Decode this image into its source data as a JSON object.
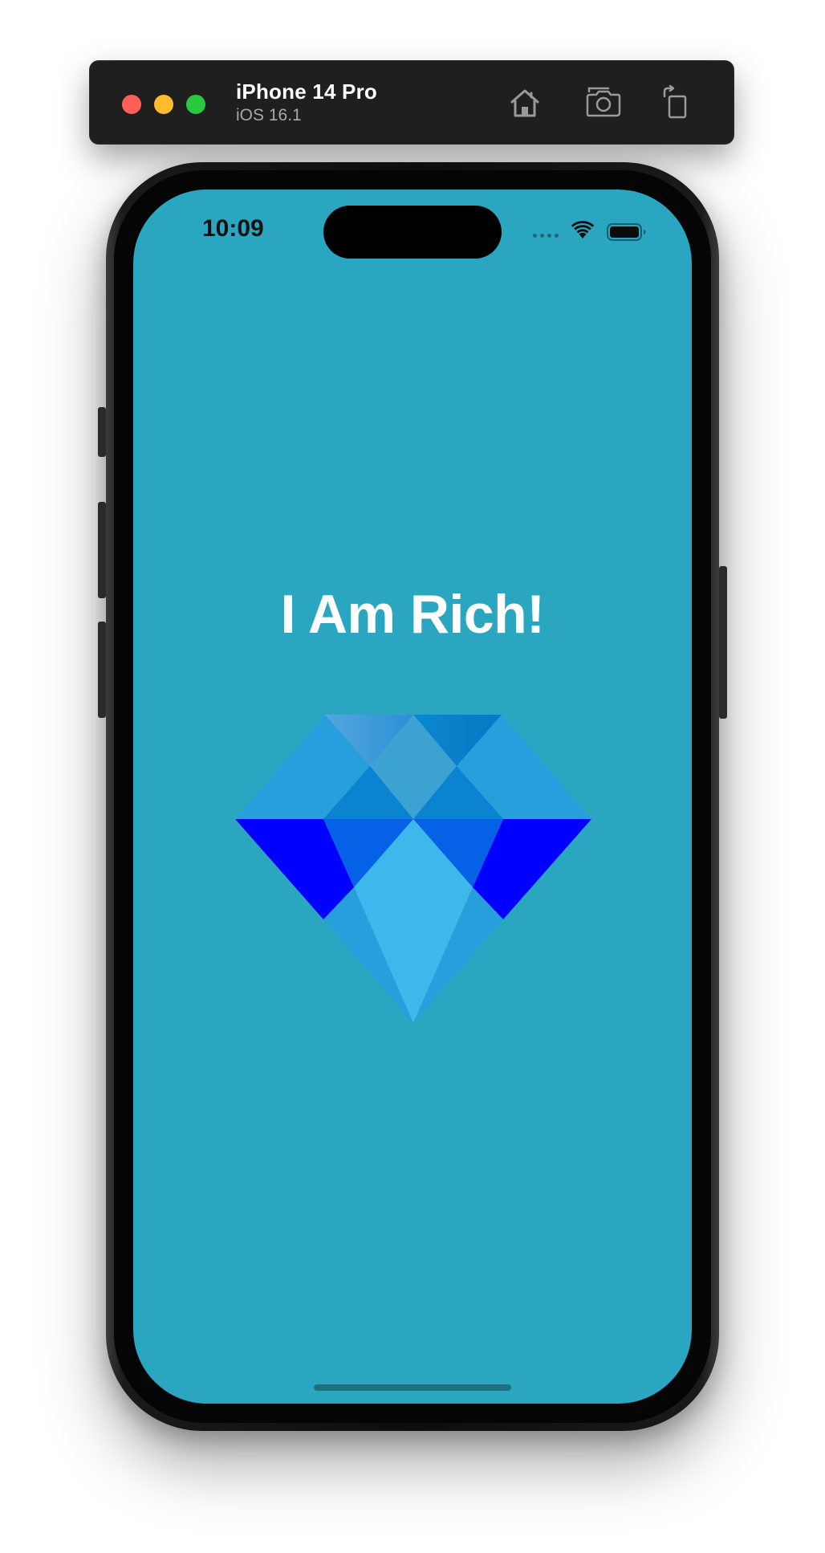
{
  "simulator": {
    "device_name": "iPhone 14 Pro",
    "os_version": "iOS 16.1",
    "toolbar_icons": [
      "home-icon",
      "screenshot-icon",
      "rotate-icon"
    ]
  },
  "status_bar": {
    "time": "10:09",
    "icons": [
      "cellular-signal-icon",
      "wifi-icon",
      "battery-icon"
    ]
  },
  "app": {
    "title": "I Am Rich!",
    "background_color": "#2aa6c1",
    "image": "diamond-icon"
  },
  "colors": {
    "traffic_red": "#fe5f57",
    "traffic_yellow": "#febc2e",
    "traffic_green": "#28c840",
    "screen_background": "#2aa6c1"
  }
}
